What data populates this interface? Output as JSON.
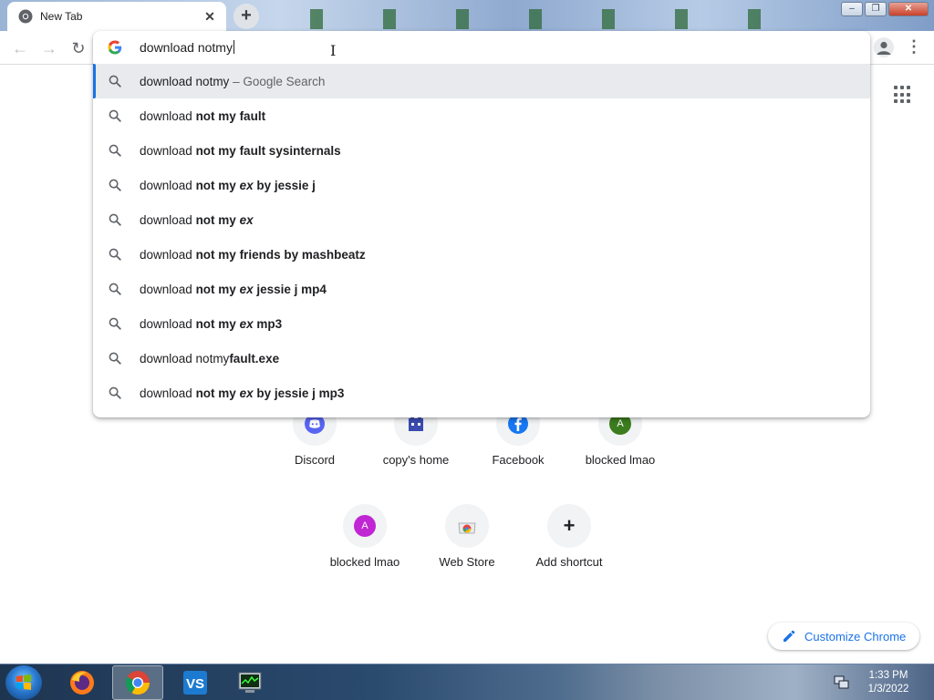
{
  "tab": {
    "title": "New Tab",
    "close": "✕"
  },
  "newtab": "+",
  "window": {
    "minimize": "–",
    "restore": "❐",
    "close": "✕"
  },
  "nav": {
    "back": "←",
    "forward": "→",
    "reload": "↻"
  },
  "omnibox": {
    "value": "download notmy"
  },
  "suggestions": [
    {
      "parts": [
        {
          "t": "download notmy",
          "s": "n"
        },
        {
          "t": " – Google Search",
          "s": "m"
        }
      ]
    },
    {
      "parts": [
        {
          "t": "download ",
          "s": "n"
        },
        {
          "t": "not my fault",
          "s": "b"
        }
      ]
    },
    {
      "parts": [
        {
          "t": "download ",
          "s": "n"
        },
        {
          "t": "not my fault sysinternals",
          "s": "b"
        }
      ]
    },
    {
      "parts": [
        {
          "t": "download ",
          "s": "n"
        },
        {
          "t": "not my ",
          "s": "b"
        },
        {
          "t": "ex",
          "s": "i"
        },
        {
          "t": " by jessie j",
          "s": "b"
        }
      ]
    },
    {
      "parts": [
        {
          "t": "download ",
          "s": "n"
        },
        {
          "t": "not my ",
          "s": "b"
        },
        {
          "t": "ex",
          "s": "i"
        }
      ]
    },
    {
      "parts": [
        {
          "t": "download ",
          "s": "n"
        },
        {
          "t": "not my friends by mashbeatz",
          "s": "b"
        }
      ]
    },
    {
      "parts": [
        {
          "t": "download ",
          "s": "n"
        },
        {
          "t": "not my ",
          "s": "b"
        },
        {
          "t": "ex",
          "s": "i"
        },
        {
          "t": " jessie j mp4",
          "s": "b"
        }
      ]
    },
    {
      "parts": [
        {
          "t": "download ",
          "s": "n"
        },
        {
          "t": "not my ",
          "s": "b"
        },
        {
          "t": "ex",
          "s": "i"
        },
        {
          "t": " mp3",
          "s": "b"
        }
      ]
    },
    {
      "parts": [
        {
          "t": "download notmy",
          "s": "n"
        },
        {
          "t": "fault.exe",
          "s": "b"
        }
      ]
    },
    {
      "parts": [
        {
          "t": "download ",
          "s": "n"
        },
        {
          "t": "not my ",
          "s": "b"
        },
        {
          "t": "ex",
          "s": "i"
        },
        {
          "t": " by jessie j mp3",
          "s": "b"
        }
      ]
    }
  ],
  "shortcuts": [
    {
      "label": "Discord",
      "icon": "discord-icon"
    },
    {
      "label": "copy's home",
      "icon": "game-icon"
    },
    {
      "label": "Facebook",
      "icon": "facebook-icon"
    },
    {
      "label": "blocked lmao",
      "icon": "letter-avatar",
      "letter": "A",
      "color": "#3c7c1e"
    },
    {
      "label": "blocked lmao",
      "icon": "letter-avatar",
      "letter": "A",
      "color": "#c026d3"
    },
    {
      "label": "Web Store",
      "icon": "webstore-icon"
    },
    {
      "label": "Add shortcut",
      "icon": "plus-icon",
      "glyph": "+"
    }
  ],
  "customize": {
    "label": "Customize Chrome"
  },
  "taskbar": {
    "time": "1:33 PM",
    "date": "1/3/2022",
    "items": [
      "firefox-icon",
      "chrome-icon",
      "vs-code-icon",
      "task-manager-icon"
    ]
  },
  "colors": {
    "accent": "#1a73e8",
    "selection": "#e8eaed"
  }
}
